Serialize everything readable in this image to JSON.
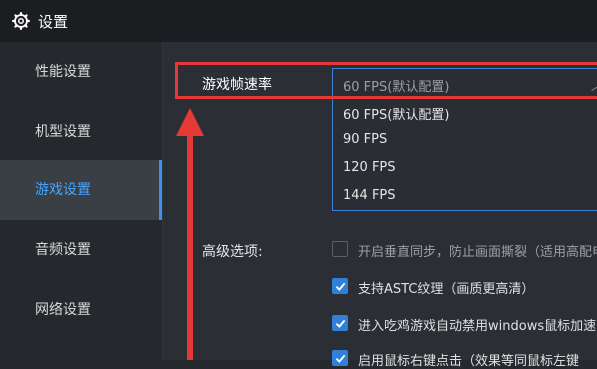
{
  "window": {
    "title": "设置",
    "icon": "gear-icon"
  },
  "sidebar": {
    "items": [
      {
        "label": "性能设置",
        "active": false
      },
      {
        "label": "机型设置",
        "active": false
      },
      {
        "label": "游戏设置",
        "active": true
      },
      {
        "label": "音频设置",
        "active": false
      },
      {
        "label": "网络设置",
        "active": false
      }
    ]
  },
  "game": {
    "fps_label": "游戏帧速率",
    "fps_selected": "60 FPS(默认配置)",
    "fps_options": [
      "60 FPS(默认配置)",
      "90 FPS",
      "120 FPS",
      "144 FPS"
    ],
    "advanced_label": "高级选项:",
    "advanced_options": [
      {
        "label": "开启垂直同步，防止画面撕裂（适用高配电脑",
        "checked": false
      },
      {
        "label": "支持ASTC纹理（画质更高清）",
        "checked": true
      },
      {
        "label": "进入吃鸡游戏自动禁用windows鼠标加速，射",
        "checked": true
      },
      {
        "label": "启用鼠标右键点击（效果等同鼠标左键",
        "checked": true
      }
    ]
  },
  "colors": {
    "accent": "#3d8ff0",
    "annotation": "#e53935",
    "active_text": "#46a7ff"
  }
}
